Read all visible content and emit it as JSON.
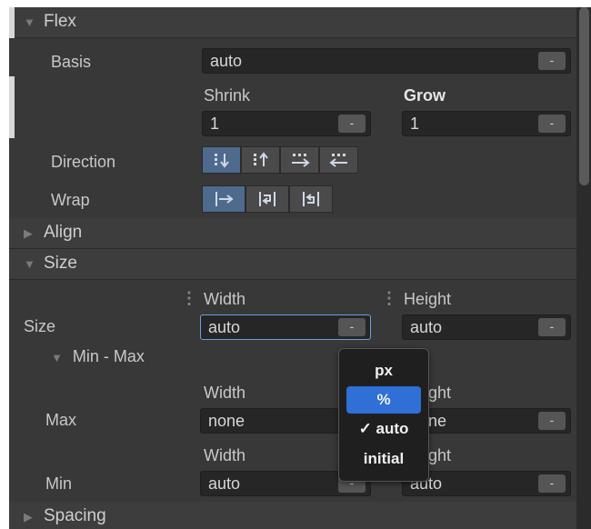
{
  "sections": {
    "flex": "Flex",
    "align": "Align",
    "size": "Size",
    "spacing": "Spacing"
  },
  "flex": {
    "basis_label": "Basis",
    "basis_value": "auto",
    "shrink_label": "Shrink",
    "grow_label": "Grow",
    "shrink_value": "1",
    "grow_value": "1",
    "direction_label": "Direction",
    "wrap_label": "Wrap",
    "dropdown_glyph": "-"
  },
  "size": {
    "width_label": "Width",
    "height_label": "Height",
    "size_label": "Size",
    "size_width_value": "auto",
    "size_height_value": "auto",
    "minmax_label": "Min - Max",
    "max_label": "Max",
    "max_width_label": "Width",
    "max_height_label": "Height",
    "max_width_value": "none",
    "max_height_value": "none",
    "min_label": "Min",
    "min_width_label": "Width",
    "min_height_label": "Height",
    "min_width_value": "auto",
    "min_height_value": "auto"
  },
  "units_popup": {
    "options": [
      "px",
      "%",
      "✓ auto",
      "initial"
    ],
    "highlighted": "%",
    "checked": "auto"
  },
  "icons": {
    "direction": [
      "column-icon",
      "column-reverse-icon",
      "row-icon",
      "row-reverse-icon"
    ],
    "wrap": [
      "nowrap-icon",
      "wrap-icon",
      "wrap-reverse-icon"
    ]
  },
  "colors": {
    "accent": "#2f6fd6",
    "active_button": "#4e6a8c",
    "focus_border": "#6a9fe0"
  }
}
